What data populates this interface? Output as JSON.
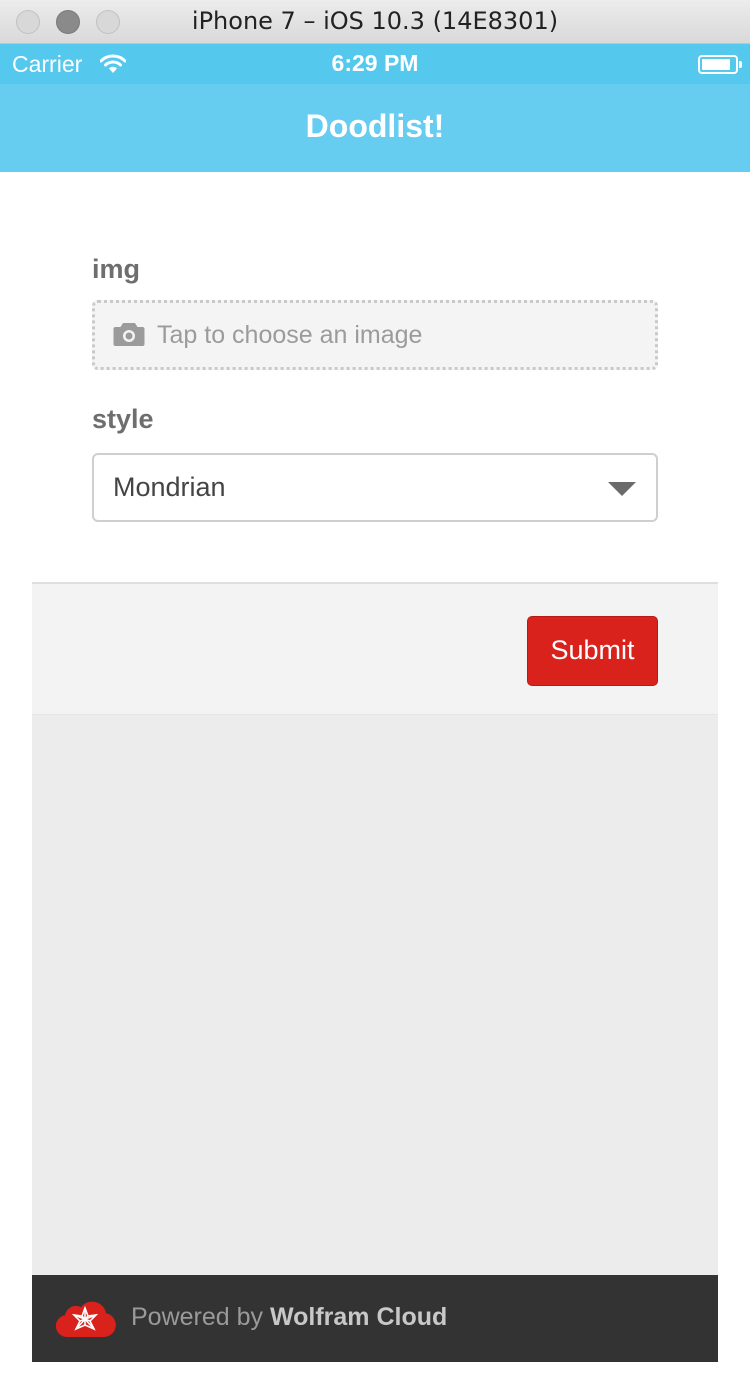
{
  "window": {
    "title": "iPhone 7 – iOS 10.3 (14E8301)"
  },
  "status_bar": {
    "carrier": "Carrier",
    "time": "6:29 PM",
    "wifi_icon": "wifi-icon",
    "battery_icon": "battery-icon"
  },
  "app": {
    "title": "Doodlist!",
    "header_color": "#67cdf0"
  },
  "form": {
    "img_label": "img",
    "img_placeholder": "Tap to choose an image",
    "img_icon": "camera-icon",
    "style_label": "style",
    "style_value": "Mondrian",
    "style_icon": "chevron-down-icon"
  },
  "actions": {
    "submit_label": "Submit",
    "submit_color": "#d9221c"
  },
  "footer": {
    "powered_by": "Powered by ",
    "brand": "Wolfram Cloud",
    "logo_icon": "wolfram-logo-icon"
  }
}
